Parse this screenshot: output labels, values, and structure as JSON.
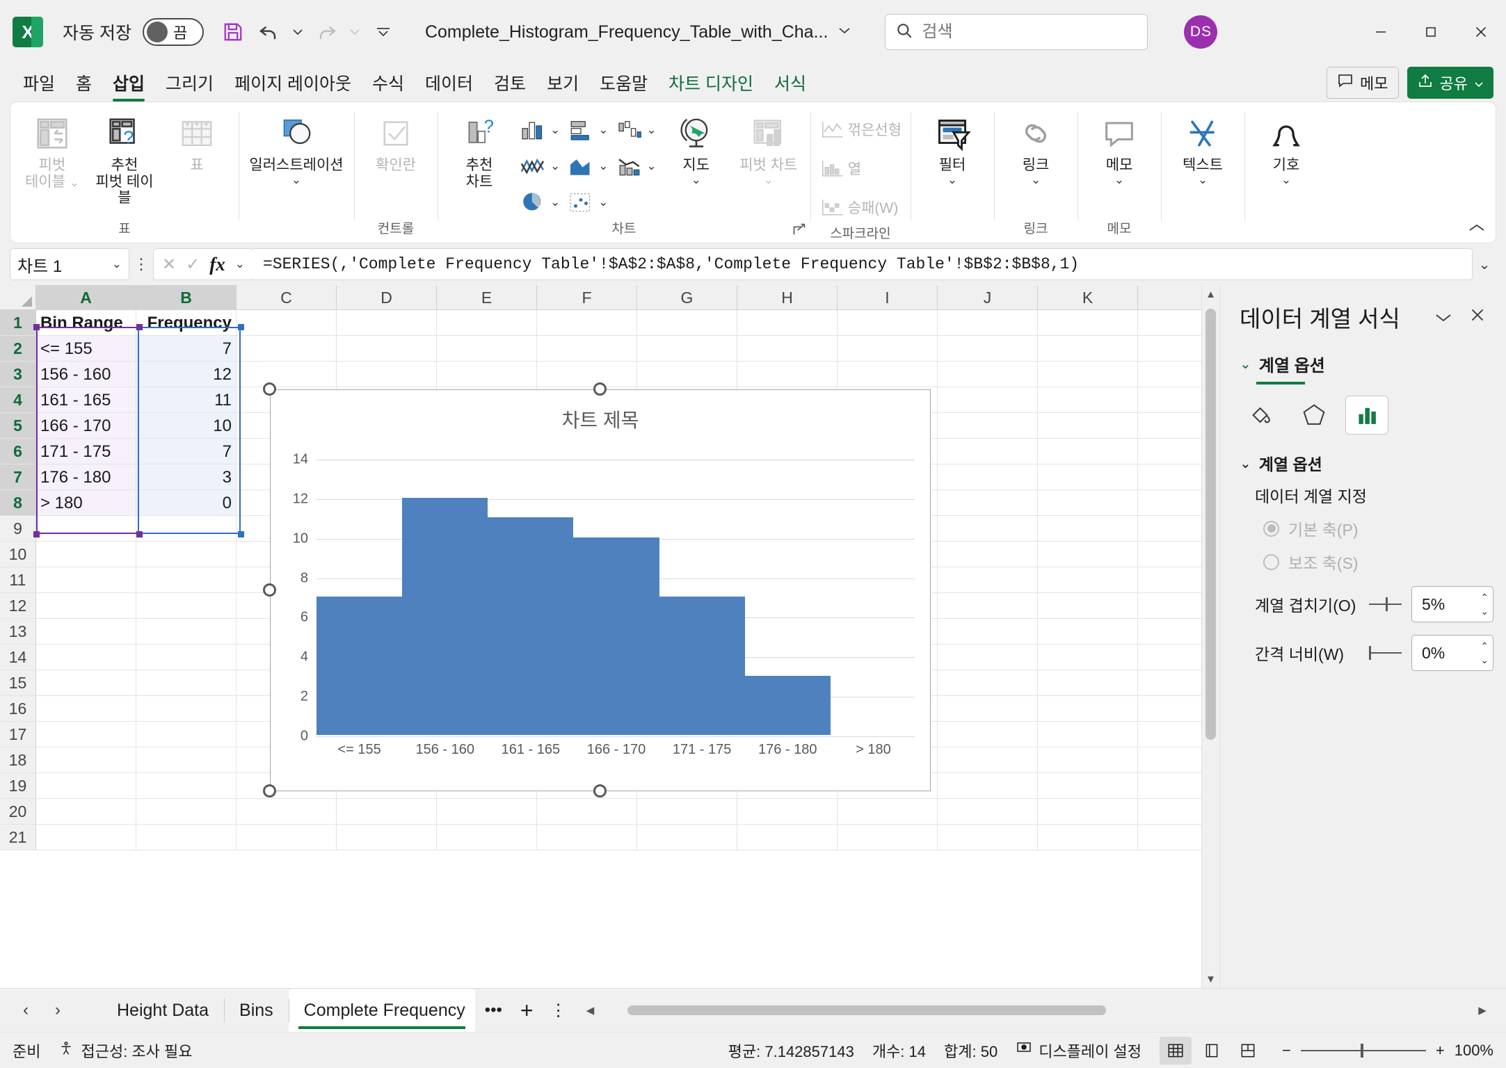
{
  "titlebar": {
    "autosave_label": "자동 저장",
    "autosave_state": "끔",
    "doc_title": "Complete_Histogram_Frequency_Table_with_Cha...",
    "icons": {
      "save": "save-icon",
      "undo": "undo-icon",
      "redo": "redo-icon",
      "customize": "customize-quick-access-icon"
    }
  },
  "search": {
    "placeholder": "검색",
    "icon": "search-icon"
  },
  "account": {
    "initials": "DS"
  },
  "window": {
    "minimize": "–",
    "maximize": "□",
    "close": "✕"
  },
  "ribbon_tabs": [
    {
      "label": "파일",
      "state": "normal"
    },
    {
      "label": "홈",
      "state": "normal"
    },
    {
      "label": "삽입",
      "state": "active"
    },
    {
      "label": "그리기",
      "state": "normal"
    },
    {
      "label": "페이지 레이아웃",
      "state": "normal"
    },
    {
      "label": "수식",
      "state": "normal"
    },
    {
      "label": "데이터",
      "state": "normal"
    },
    {
      "label": "검토",
      "state": "normal"
    },
    {
      "label": "보기",
      "state": "normal"
    },
    {
      "label": "도움말",
      "state": "normal"
    },
    {
      "label": "차트 디자인",
      "state": "contextual"
    },
    {
      "label": "서식",
      "state": "contextual"
    }
  ],
  "tabstrip_right": {
    "memo_label": "메모",
    "share_label": "공유"
  },
  "ribbon": {
    "groups": [
      {
        "name": "표",
        "label": "표",
        "items": [
          {
            "label": "피벗\n테이블",
            "icon": "pivot-table-icon",
            "disabled": true,
            "caret": true
          },
          {
            "label": "추천\n피벗 테이블",
            "icon": "recommended-pivot-table-icon",
            "disabled": false,
            "caret": false
          },
          {
            "label": "표",
            "icon": "table-icon",
            "disabled": true,
            "caret": false
          }
        ]
      },
      {
        "name": "일러스트레이션",
        "label": "",
        "items": [
          {
            "label": "일러스트레이션",
            "icon": "illustrations-icon",
            "disabled": false,
            "caret": true
          }
        ]
      },
      {
        "name": "컨트롤",
        "label": "컨트롤",
        "items": [
          {
            "label": "확인란",
            "icon": "checkbox-icon",
            "disabled": true,
            "caret": false
          }
        ]
      },
      {
        "name": "차트",
        "label": "차트",
        "items": [
          {
            "label": "추천\n차트",
            "icon": "recommended-charts-icon",
            "disabled": false,
            "caret": false
          },
          {
            "label": "",
            "icon": "column-chart-icon",
            "disabled": false,
            "caret": true
          },
          {
            "label": "",
            "icon": "line-chart-icon",
            "disabled": false,
            "caret": true
          },
          {
            "label": "",
            "icon": "pie-chart-icon",
            "disabled": false,
            "caret": true
          },
          {
            "label": "",
            "icon": "bar-chart-icon",
            "disabled": false,
            "caret": true
          },
          {
            "label": "",
            "icon": "area-chart-icon",
            "disabled": false,
            "caret": true
          },
          {
            "label": "",
            "icon": "scatter-chart-icon",
            "disabled": false,
            "caret": true
          },
          {
            "label": "",
            "icon": "waterfall-chart-icon",
            "disabled": false,
            "caret": true
          },
          {
            "label": "",
            "icon": "combo-chart-icon",
            "disabled": false,
            "caret": true
          },
          {
            "label": "지도",
            "icon": "map-chart-icon",
            "disabled": false,
            "caret": true
          },
          {
            "label": "피벗 차트",
            "icon": "pivot-chart-icon",
            "disabled": true,
            "caret": true
          }
        ]
      },
      {
        "name": "스파크라인",
        "label": "스파크라인",
        "items": [
          {
            "label": "꺾은선형",
            "icon": "sparkline-line-icon",
            "disabled": true
          },
          {
            "label": "열",
            "icon": "sparkline-column-icon",
            "disabled": true
          },
          {
            "label": "승패(W)",
            "icon": "sparkline-winloss-icon",
            "disabled": true
          }
        ]
      },
      {
        "name": "필터",
        "label": "",
        "items": [
          {
            "label": "필터",
            "icon": "filter-icon",
            "disabled": false,
            "caret": true
          }
        ]
      },
      {
        "name": "링크",
        "label": "링크",
        "items": [
          {
            "label": "링크",
            "icon": "link-icon",
            "disabled": false,
            "caret": true
          }
        ]
      },
      {
        "name": "메모",
        "label": "메모",
        "items": [
          {
            "label": "메모",
            "icon": "comment-icon",
            "disabled": false,
            "caret": true
          }
        ]
      },
      {
        "name": "텍스트",
        "label": "",
        "items": [
          {
            "label": "텍스트",
            "icon": "text-icon",
            "disabled": false,
            "caret": true
          }
        ]
      },
      {
        "name": "기호",
        "label": "",
        "items": [
          {
            "label": "기호",
            "icon": "symbol-icon",
            "disabled": false,
            "caret": true
          }
        ]
      }
    ],
    "collapse_icon": "collapse-ribbon-icon"
  },
  "formula_bar": {
    "name_box": "차트 1",
    "cancel_icon": "cancel-icon",
    "enter_icon": "enter-icon",
    "fx_icon": "insert-function-icon",
    "formula": "=SERIES(,'Complete Frequency Table'!$A$2:$A$8,'Complete Frequency Table'!$B$2:$B$8,1)",
    "expand_icon": "expand-formula-bar-icon"
  },
  "grid": {
    "columns": [
      "A",
      "B",
      "C",
      "D",
      "E",
      "F",
      "G",
      "H",
      "I",
      "J",
      "K"
    ],
    "rows": [
      "1",
      "2",
      "3",
      "4",
      "5",
      "6",
      "7",
      "8",
      "9",
      "10",
      "11",
      "12",
      "13",
      "14",
      "15",
      "16",
      "17",
      "18",
      "19",
      "20",
      "21"
    ],
    "cells": [
      {
        "row": 1,
        "a": "Bin Range",
        "b": "Frequency"
      },
      {
        "row": 2,
        "a": "<= 155",
        "b": "7"
      },
      {
        "row": 3,
        "a": "156 - 160",
        "b": "12"
      },
      {
        "row": 4,
        "a": "161 - 165",
        "b": "11"
      },
      {
        "row": 5,
        "a": "166 - 170",
        "b": "10"
      },
      {
        "row": 6,
        "a": "171 - 175",
        "b": "7"
      },
      {
        "row": 7,
        "a": "176 - 180",
        "b": "3"
      },
      {
        "row": 8,
        "a": "> 180",
        "b": "0"
      }
    ],
    "selection_colors": {
      "series_x": "#7030a0",
      "series_y": "#2f6fc0"
    }
  },
  "chart_data": {
    "type": "bar",
    "title": "차트 제목",
    "categories": [
      "<= 155",
      "156 - 160",
      "161 - 165",
      "166 - 170",
      "171 - 175",
      "176 - 180",
      "> 180"
    ],
    "values": [
      7,
      12,
      11,
      10,
      7,
      3,
      0
    ],
    "series": [
      {
        "name": "Frequency",
        "values": [
          7,
          12,
          11,
          10,
          7,
          3,
          0
        ]
      }
    ],
    "xlabel": "",
    "ylabel": "",
    "ylim": [
      0,
      14
    ],
    "yticks": [
      0,
      2,
      4,
      6,
      8,
      10,
      12,
      14
    ],
    "grid": true,
    "legend": "none",
    "bar_color": "#4e81bd",
    "gap_width_pct": 0,
    "overlap_pct": 5
  },
  "task_pane": {
    "title": "데이터 계열 서식",
    "collapse_icon": "chevron-down-icon",
    "close_icon": "close-icon",
    "section_title": "계열 옵션",
    "icon_tabs": [
      {
        "name": "fill-and-line-icon",
        "active": false
      },
      {
        "name": "effects-icon",
        "active": false
      },
      {
        "name": "series-options-icon",
        "active": true
      }
    ],
    "sub_section_title": "계열 옵션",
    "plot_series_on_label": "데이터 계열 지정",
    "radio_primary": "기본 축(P)",
    "radio_secondary": "보조 축(S)",
    "overlap_label": "계열 겹치기(O)",
    "overlap_value": "5%",
    "gap_label": "간격 너비(W)",
    "gap_value": "0%"
  },
  "sheet_tabs": {
    "prev_icon": "previous-sheet-icon",
    "next_icon": "next-sheet-icon",
    "tabs": [
      {
        "label": "Height Data",
        "active": false
      },
      {
        "label": "Bins",
        "active": false
      },
      {
        "label": "Complete Frequency",
        "active": true
      }
    ],
    "more_icon": "more-sheets-icon",
    "add_label": "+",
    "kebab_icon": "sheet-options-icon"
  },
  "status_bar": {
    "mode": "준비",
    "accessibility": "접근성: 조사 필요",
    "accessibility_icon": "accessibility-icon",
    "average": "평균: 7.142857143",
    "count": "개수: 14",
    "sum": "합계: 50",
    "display_settings": "디스플레이 설정",
    "display_settings_icon": "display-settings-icon",
    "views": [
      {
        "name": "normal-view-icon",
        "active": true
      },
      {
        "name": "page-layout-view-icon",
        "active": false
      },
      {
        "name": "page-break-preview-icon",
        "active": false
      }
    ],
    "zoom_out": "−",
    "zoom_in": "+",
    "zoom_level": "100%"
  }
}
